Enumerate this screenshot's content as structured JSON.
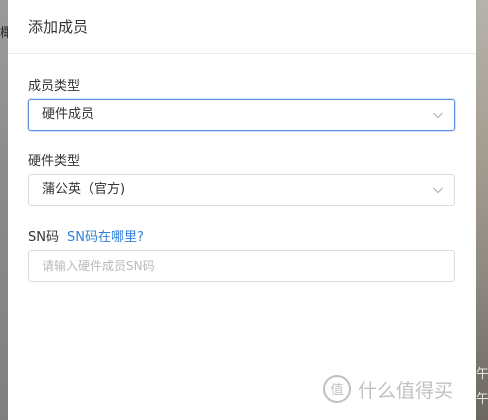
{
  "background": {
    "left_peek_text": "椰",
    "right_peek_text_1": "午",
    "right_peek_text_2": "午"
  },
  "modal": {
    "title": "添加成员"
  },
  "form": {
    "member_type": {
      "label": "成员类型",
      "value": "硬件成员"
    },
    "hardware_type": {
      "label": "硬件类型",
      "value": "蒲公英（官方)"
    },
    "sn": {
      "label": "SN码",
      "help_link": "SN码在哪里?",
      "placeholder": "请输入硬件成员SN码",
      "value": ""
    }
  },
  "watermark": {
    "text": "什么值得买",
    "logo_char": "值"
  },
  "colors": {
    "accent": "#2f7fd6",
    "focus_border": "#5b8fd8",
    "border": "#dcdcdc",
    "text": "#333333",
    "placeholder": "#b9b9b9"
  }
}
